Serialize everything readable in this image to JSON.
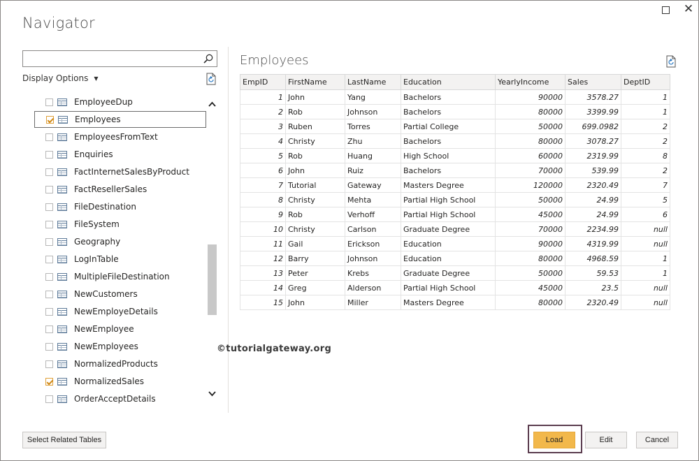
{
  "window": {
    "title": "Navigator",
    "maximize_icon": "maximize-icon",
    "close_icon": "close-icon",
    "close_glyph": "✕"
  },
  "search": {
    "value": "",
    "placeholder": ""
  },
  "display_options": {
    "label": "Display Options",
    "caret": "▼"
  },
  "list": {
    "items": [
      {
        "label": "EmployeeDup",
        "checked": false,
        "selected": false
      },
      {
        "label": "Employees",
        "checked": true,
        "selected": true
      },
      {
        "label": "EmployeesFromText",
        "checked": false,
        "selected": false
      },
      {
        "label": "Enquiries",
        "checked": false,
        "selected": false
      },
      {
        "label": "FactInternetSalesByProduct",
        "checked": false,
        "selected": false
      },
      {
        "label": "FactResellerSales",
        "checked": false,
        "selected": false
      },
      {
        "label": "FileDestination",
        "checked": false,
        "selected": false
      },
      {
        "label": "FileSystem",
        "checked": false,
        "selected": false
      },
      {
        "label": "Geography",
        "checked": false,
        "selected": false
      },
      {
        "label": "LogInTable",
        "checked": false,
        "selected": false
      },
      {
        "label": "MultipleFileDestination",
        "checked": false,
        "selected": false
      },
      {
        "label": "NewCustomers",
        "checked": false,
        "selected": false
      },
      {
        "label": "NewEmployeDetails",
        "checked": false,
        "selected": false
      },
      {
        "label": "NewEmployee",
        "checked": false,
        "selected": false
      },
      {
        "label": "NewEmployees",
        "checked": false,
        "selected": false
      },
      {
        "label": "NormalizedProducts",
        "checked": false,
        "selected": false
      },
      {
        "label": "NormalizedSales",
        "checked": true,
        "selected": false
      },
      {
        "label": "OrderAcceptDetails",
        "checked": false,
        "selected": false
      }
    ]
  },
  "preview": {
    "title": "Employees",
    "columns": [
      "EmpID",
      "FirstName",
      "LastName",
      "Education",
      "YearlyIncome",
      "Sales",
      "DeptID"
    ],
    "rows": [
      [
        "1",
        "John",
        "Yang",
        "Bachelors",
        "90000",
        "3578.27",
        "1"
      ],
      [
        "2",
        "Rob",
        "Johnson",
        "Bachelors",
        "80000",
        "3399.99",
        "1"
      ],
      [
        "3",
        "Ruben",
        "Torres",
        "Partial College",
        "50000",
        "699.0982",
        "2"
      ],
      [
        "4",
        "Christy",
        "Zhu",
        "Bachelors",
        "80000",
        "3078.27",
        "2"
      ],
      [
        "5",
        "Rob",
        "Huang",
        "High School",
        "60000",
        "2319.99",
        "8"
      ],
      [
        "6",
        "John",
        "Ruiz",
        "Bachelors",
        "70000",
        "539.99",
        "2"
      ],
      [
        "7",
        "Tutorial",
        "Gateway",
        "Masters Degree",
        "120000",
        "2320.49",
        "7"
      ],
      [
        "8",
        "Christy",
        "Mehta",
        "Partial High School",
        "50000",
        "24.99",
        "5"
      ],
      [
        "9",
        "Rob",
        "Verhoff",
        "Partial High School",
        "45000",
        "24.99",
        "6"
      ],
      [
        "10",
        "Christy",
        "Carlson",
        "Graduate Degree",
        "70000",
        "2234.99",
        "null"
      ],
      [
        "11",
        "Gail",
        "Erickson",
        "Education",
        "90000",
        "4319.99",
        "null"
      ],
      [
        "12",
        "Barry",
        "Johnson",
        "Education",
        "80000",
        "4968.59",
        "1"
      ],
      [
        "13",
        "Peter",
        "Krebs",
        "Graduate Degree",
        "50000",
        "59.53",
        "1"
      ],
      [
        "14",
        "Greg",
        "Alderson",
        "Partial High School",
        "45000",
        "23.5",
        "null"
      ],
      [
        "15",
        "John",
        "Miller",
        "Masters Degree",
        "80000",
        "2320.49",
        "null"
      ]
    ],
    "numeric_columns": [
      0,
      4,
      5,
      6
    ]
  },
  "watermark": "©tutorialgateway.org",
  "buttons": {
    "select_related": "Select Related Tables",
    "load": "Load",
    "edit": "Edit",
    "cancel": "Cancel"
  },
  "colors": {
    "accent": "#f2b84b",
    "checkbox": "#d08a19",
    "highlight_frame": "#5b3d4f"
  }
}
